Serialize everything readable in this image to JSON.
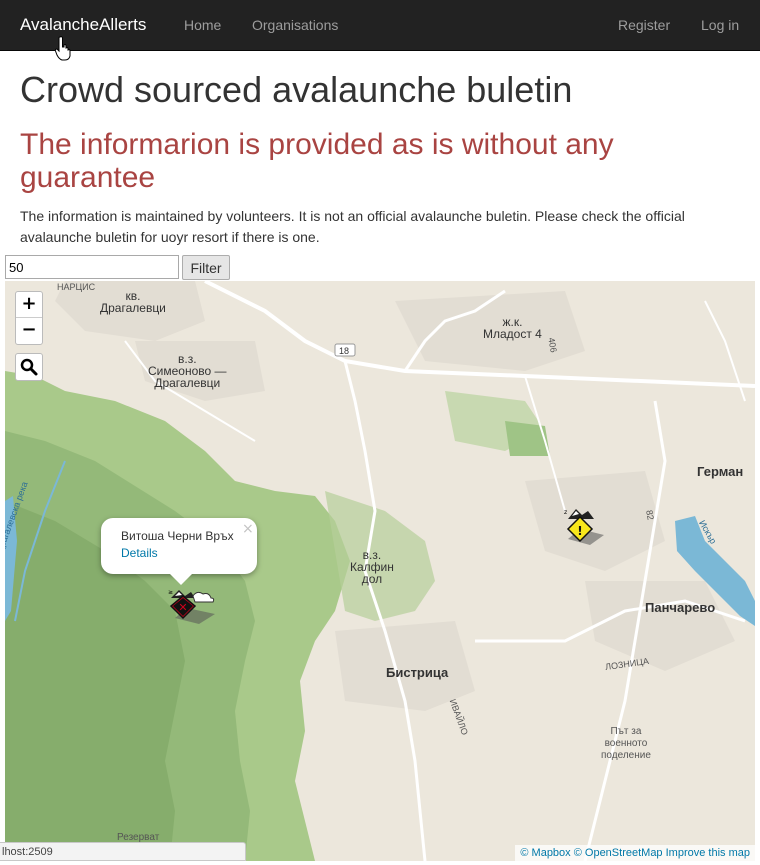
{
  "navbar": {
    "brand": "AvalancheAllerts",
    "links": [
      "Home",
      "Organisations"
    ],
    "right_links": [
      "Register",
      "Log in"
    ]
  },
  "heading": "Crowd sourced avalaunche buletin",
  "warning": "The informarion is provided as is without any guarantee",
  "info": "The information is maintained by volunteers. It is not an official avalaunche buletin. Please check the official avalaunche buletin for uoyr resort if there is one.",
  "filter": {
    "value": "50",
    "button_label": "Filter"
  },
  "map": {
    "zoom_in": "+",
    "zoom_out": "−",
    "labels": {
      "narcis": "НАРЦИС",
      "dragalevtsi": "кв.\nДрагалевци",
      "simeonovo": "в.з.\nСимеоново —\nДрагалевци",
      "mladost": "ж.к.\nМладост 4",
      "road18": "18",
      "road406": "406",
      "german": "Герман",
      "kalfin": "в.з.\nКалфин\nдол",
      "pancharevo": "Панчарево",
      "bistritsa": "Бистрица",
      "ivaylo": "ИВАЙЛО",
      "loznitsa": "ЛОЗНИЦА",
      "military": "Път за\nвоенното\nподеление",
      "iskar": "Искър",
      "road82": "82",
      "reka": "Драгалевска река",
      "rezervat": "Резерват"
    },
    "popup": {
      "title": "Витоша Черни Връх",
      "link": "Details",
      "close": "×"
    },
    "markers": [
      {
        "name": "Витоша Черни Връх",
        "level": "x",
        "color": "#d0021b"
      },
      {
        "name": "Панчарево",
        "level": "!",
        "color": "#f8e71c"
      }
    ],
    "attribution": {
      "mapbox": "© Mapbox",
      "osm": "© OpenStreetMap",
      "improve": "Improve this map"
    }
  },
  "status_bar": "lhost:2509"
}
